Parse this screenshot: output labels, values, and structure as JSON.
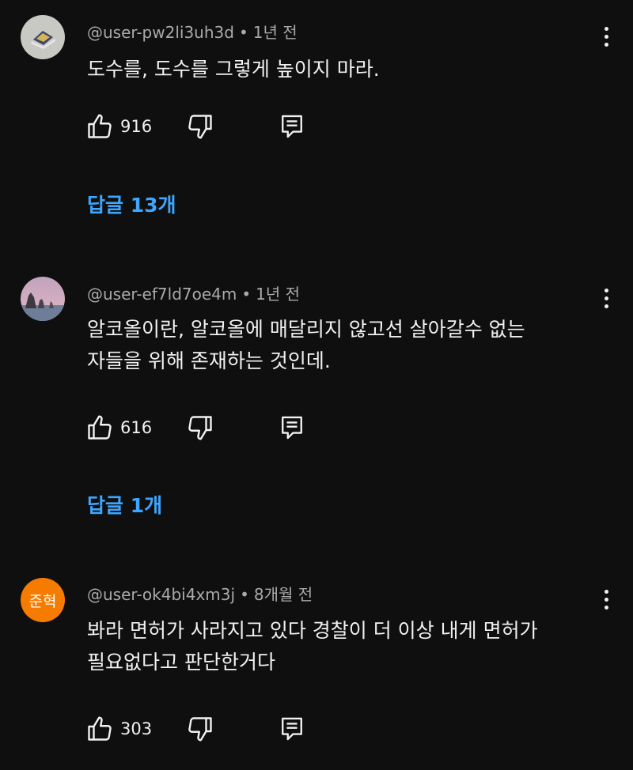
{
  "comments": [
    {
      "author": "@user-pw2li3uh3d",
      "time": "1년 전",
      "text_lines": [
        "도수를, 도수를 그렇게 높이지 마라."
      ],
      "likes": "916",
      "replies_label": "답글 13개",
      "avatar": "photo"
    },
    {
      "author": "@user-ef7ld7oe4m",
      "time": "1년 전",
      "text_lines": [
        "알코올이란, 알코올에 매달리지 않고선 살아갈수 없는",
        "자들을 위해 존재하는 것인데."
      ],
      "likes": "616",
      "replies_label": "답글 1개",
      "avatar": "photo"
    },
    {
      "author": "@user-ok4bi4xm3j",
      "time": "8개월 전",
      "text_lines": [
        "봐라 면허가 사라지고 있다 경찰이 더 이상 내게 면허가",
        "필요없다고 판단한거다"
      ],
      "likes": "303",
      "avatar": "letter",
      "avatar_text": "준혁",
      "avatar_color": "#f57c00"
    }
  ],
  "icons": {
    "like": "thumbs-up-icon",
    "dislike": "thumbs-down-icon",
    "reply": "reply-comment-icon",
    "menu": "more-vertical-icon"
  },
  "colors": {
    "background": "#0f0f0f",
    "text": "#f1f1f1",
    "meta": "#aaaaaa",
    "link": "#3ea6ff"
  }
}
